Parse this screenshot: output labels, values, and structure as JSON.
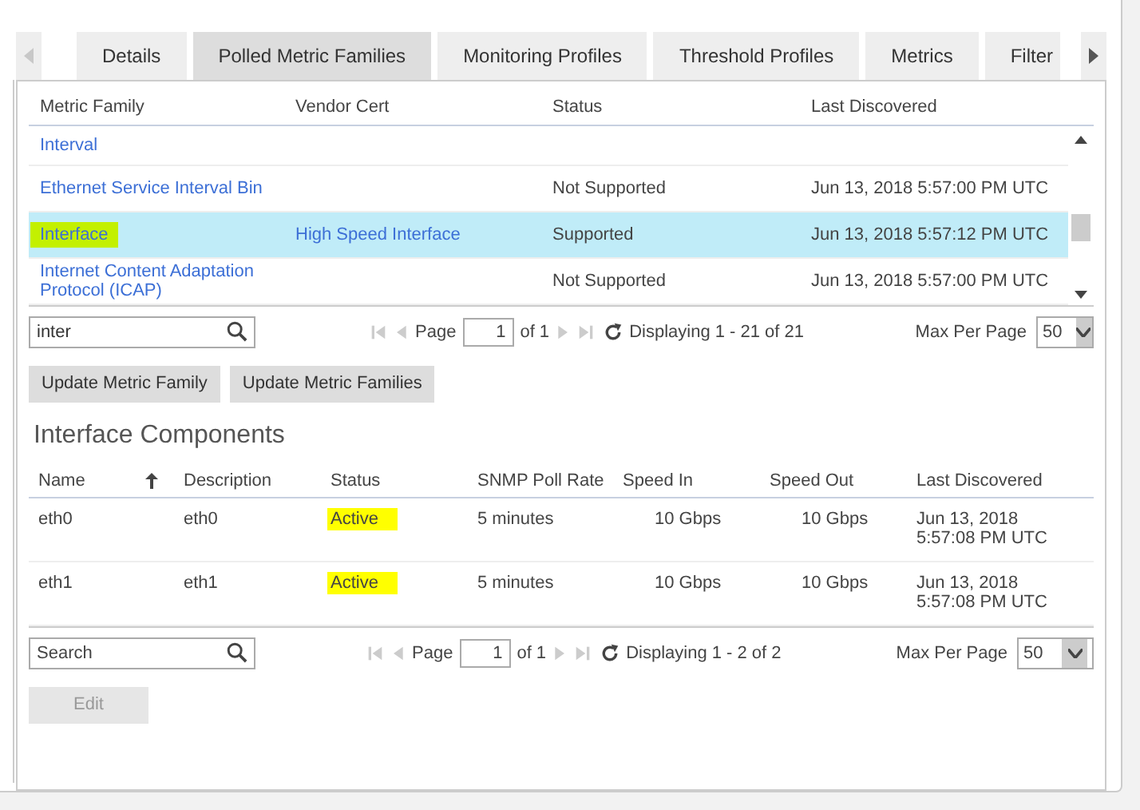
{
  "tabs": [
    {
      "label": "Details",
      "selected": false
    },
    {
      "label": "Polled Metric Families",
      "selected": true
    },
    {
      "label": "Monitoring Profiles",
      "selected": false
    },
    {
      "label": "Threshold Profiles",
      "selected": false
    },
    {
      "label": "Metrics",
      "selected": false
    },
    {
      "label": "Filter",
      "selected": false
    }
  ],
  "families": {
    "columns": [
      "Metric Family",
      "Vendor Cert",
      "Status",
      "Last Discovered"
    ],
    "rows": [
      {
        "family": "Interval",
        "selected": false,
        "highlighted": false
      },
      {
        "family": "Ethernet Service Interval Bin",
        "status": "Not Supported",
        "last_discovered": "Jun 13, 2018 5:57:00 PM UTC",
        "selected": false,
        "highlighted": false
      },
      {
        "family": "Interface",
        "vendor_cert": "High Speed Interface",
        "status": "Supported",
        "last_discovered": "Jun 13, 2018 5:57:12 PM UTC",
        "selected": true,
        "highlighted": true
      },
      {
        "family": "Internet Content Adaptation Protocol (ICAP)",
        "status": "Not Supported",
        "last_discovered": "Jun 13, 2018 5:57:00 PM UTC",
        "selected": false,
        "highlighted": false
      }
    ],
    "pager": {
      "search": "inter",
      "page_label": "Page",
      "page": "1",
      "of": "of 1",
      "displaying": "Displaying 1 - 21 of 21",
      "max_label": "Max Per Page",
      "max": "50"
    }
  },
  "family_buttons": [
    "Update Metric Family",
    "Update Metric Families"
  ],
  "components": {
    "title": "Interface Components",
    "columns": [
      {
        "label": "Name",
        "sorted": true
      },
      {
        "label": "Description",
        "sorted": false
      },
      {
        "label": "Status",
        "sorted": false
      },
      {
        "label": "SNMP Poll Rate",
        "sorted": false
      },
      {
        "label": "Speed In",
        "sorted": false
      },
      {
        "label": "Speed Out",
        "sorted": false
      },
      {
        "label": "Last Discovered",
        "sorted": false
      }
    ],
    "rows": [
      {
        "name": "eth0",
        "description": "eth0",
        "status": "Active",
        "status_highlighted": true,
        "poll_rate": "5 minutes",
        "speed_in": "10 Gbps",
        "speed_out": "10 Gbps",
        "last_discovered": "Jun 13, 2018 5:57:08 PM UTC"
      },
      {
        "name": "eth1",
        "description": "eth1",
        "status": "Active",
        "status_highlighted": true,
        "poll_rate": "5 minutes",
        "speed_in": "10 Gbps",
        "speed_out": "10 Gbps",
        "last_discovered": "Jun 13, 2018 5:57:08 PM UTC"
      }
    ],
    "pager": {
      "placeholder": "Search",
      "page_label": "Page",
      "page": "1",
      "of": "of 1",
      "displaying": "Displaying 1 - 2 of 2",
      "max_label": "Max Per Page",
      "max": "50"
    }
  },
  "edit_button": {
    "label": "Edit",
    "disabled": true
  }
}
